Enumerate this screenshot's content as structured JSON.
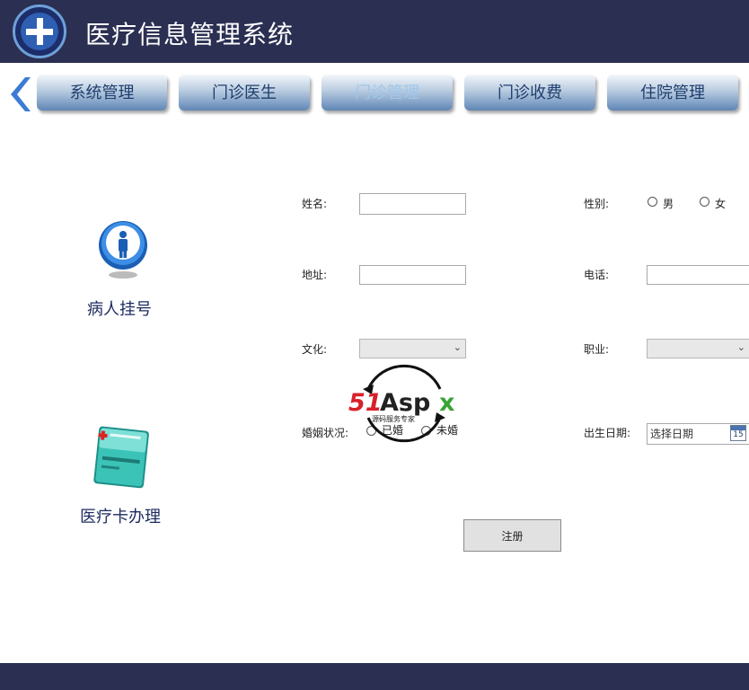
{
  "header": {
    "title": "医疗信息管理系统"
  },
  "nav": {
    "tabs": [
      {
        "label": "系统管理",
        "active": false
      },
      {
        "label": "门诊医生",
        "active": false
      },
      {
        "label": "门诊管理",
        "active": true
      },
      {
        "label": "门诊收费",
        "active": false
      },
      {
        "label": "住院管理",
        "active": false
      }
    ]
  },
  "sidebar": {
    "items": [
      {
        "label": "病人挂号",
        "icon": "person-info-icon"
      },
      {
        "label": "医疗卡办理",
        "icon": "medical-card-icon"
      }
    ]
  },
  "form": {
    "name_label": "姓名:",
    "gender_label": "性别:",
    "gender_options": [
      "男",
      "女"
    ],
    "address_label": "地址:",
    "phone_label": "电话:",
    "education_label": "文化:",
    "occupation_label": "职业:",
    "marital_label": "婚姻状况:",
    "marital_options": [
      "已婚",
      "未婚"
    ],
    "birthdate_label": "出生日期:",
    "birthdate_placeholder": "选择日期",
    "calendar_day": "15",
    "submit_label": "注册"
  },
  "watermark": {
    "brand": "51Aspx",
    "tagline": "源码服务专家"
  },
  "colors": {
    "header_bg": "#2b2f52",
    "tab_text": "#1f3e6d",
    "tab_active_text": "#9fc6ea"
  }
}
